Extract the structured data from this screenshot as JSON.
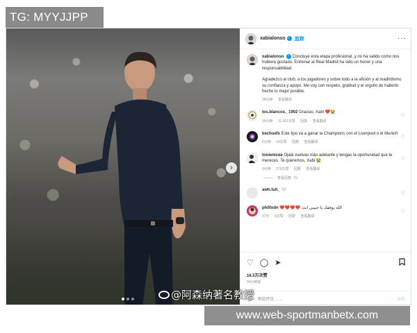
{
  "watermark_top": "TG: MYYJJPP",
  "watermark_url": "www.web-sportmanbetx.com",
  "weibo_watermark": "@阿森纳著名教授",
  "post": {
    "username": "xabialonso",
    "follow_label": "追踪",
    "more_label": "···",
    "caption": {
      "username": "xabialonso",
      "paragraph1": "Concluye esta etapa profesional, y no ha salido como nos hubiera gustado. Entrenar al Real Madrid ha sido un honor y una responsabilidad.",
      "paragraph2": "Agradezco al club, a los jugadores y sobre todo a la afición y al madridismo su confianza y apoyo. Me voy con respeto, gratitud y el orgullo de haberlo hecho lo mejor posible.",
      "time": "28分钟",
      "translation": "查看翻译"
    },
    "comments": [
      {
        "username": "los.blancos._1902",
        "text": "Gracias, Xabi ❤️😭",
        "time": "35分钟",
        "likes": "11,051次赞",
        "reply": "回复",
        "translate": "查看翻译"
      },
      {
        "username": "kechuefx",
        "text": "Este tipo va a ganar la Champions con el Liverpool o el Munich",
        "time": "6分钟",
        "likes": "10次赞",
        "reply": "回复",
        "translate": "查看翻译"
      },
      {
        "username": "toniemcee",
        "text": "Ojalá vuelvas más adelante y tengas la oportunidad que te mereces. Te queremos, Xabi 😭",
        "time": "9分钟",
        "likes": "379次赞",
        "reply": "回复",
        "translate": "查看翻译"
      },
      {
        "username": "awh.tuh_",
        "text": "🤍",
        "time": "",
        "likes": "",
        "reply": "",
        "translate": ""
      },
      {
        "username": "philfodn",
        "text": "❤️❤️❤️❤️ الله يوفقك يا حبيبي انت",
        "time": "37分",
        "likes": "9次赞",
        "reply": "回复",
        "translate": "查看翻译"
      }
    ],
    "view_replies": "查看回复（5）",
    "likes": "16.5万次赞",
    "date": "24分钟前",
    "add_comment_placeholder": "添加评论……",
    "post_button": "发布"
  }
}
